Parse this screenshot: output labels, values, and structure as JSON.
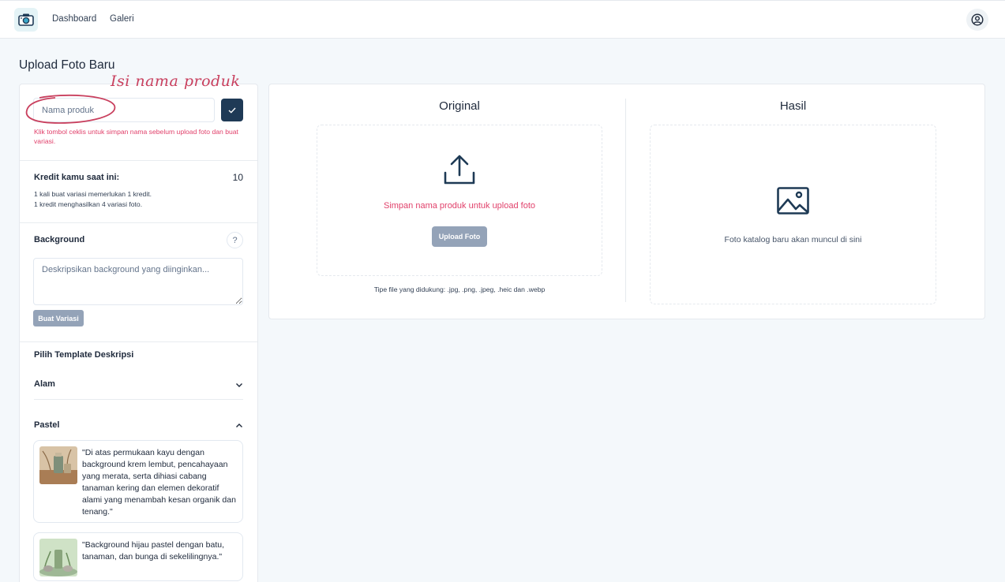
{
  "nav": {
    "logo_icon": "camera-icon",
    "links": [
      "Dashboard",
      "Galeri"
    ],
    "user_icon": "user-circle-icon"
  },
  "page_title": "Upload Foto Baru",
  "annotation": "Isi nama produk",
  "product": {
    "name_placeholder": "Nama produk",
    "save_icon": "check-icon",
    "hint": "Klik tombol ceklis untuk simpan nama sebelum upload foto dan buat variasi."
  },
  "credit": {
    "label": "Kredit kamu saat ini:",
    "value": "10",
    "note_line1": "1 kali buat variasi memerlukan 1 kredit.",
    "note_line2": "1 kredit menghasilkan 4 variasi foto."
  },
  "background": {
    "label": "Background",
    "help": "?",
    "placeholder": "Deskripsikan background yang diinginkan...",
    "button": "Buat Variasi"
  },
  "templates": {
    "label": "Pilih Template Deskripsi",
    "groups": [
      {
        "name": "Alam",
        "expanded": false
      },
      {
        "name": "Pastel",
        "expanded": true
      }
    ],
    "cards": [
      {
        "text": "\"Di atas permukaan kayu dengan background krem lembut, pencahayaan yang merata, serta dihiasi cabang tanaman kering dan elemen dekoratif alami yang menambah kesan organik dan tenang.\""
      },
      {
        "text": "\"Background hijau pastel dengan batu, tanaman, dan bunga di sekelilingnya.\""
      }
    ]
  },
  "original": {
    "title": "Original",
    "icon": "upload-icon",
    "message": "Simpan nama produk untuk upload foto",
    "button": "Upload Foto",
    "filetypes": "Tipe file yang didukung: .jpg, .png, .jpeg, .heic dan .webp"
  },
  "hasil": {
    "title": "Hasil",
    "icon": "image-icon",
    "message": "Foto katalog baru akan muncul di sini"
  },
  "colors": {
    "primary": "#1f3a56",
    "accent_red": "#e1416b",
    "disabled": "#94a3b8",
    "page_bg": "#f4f8fb"
  }
}
